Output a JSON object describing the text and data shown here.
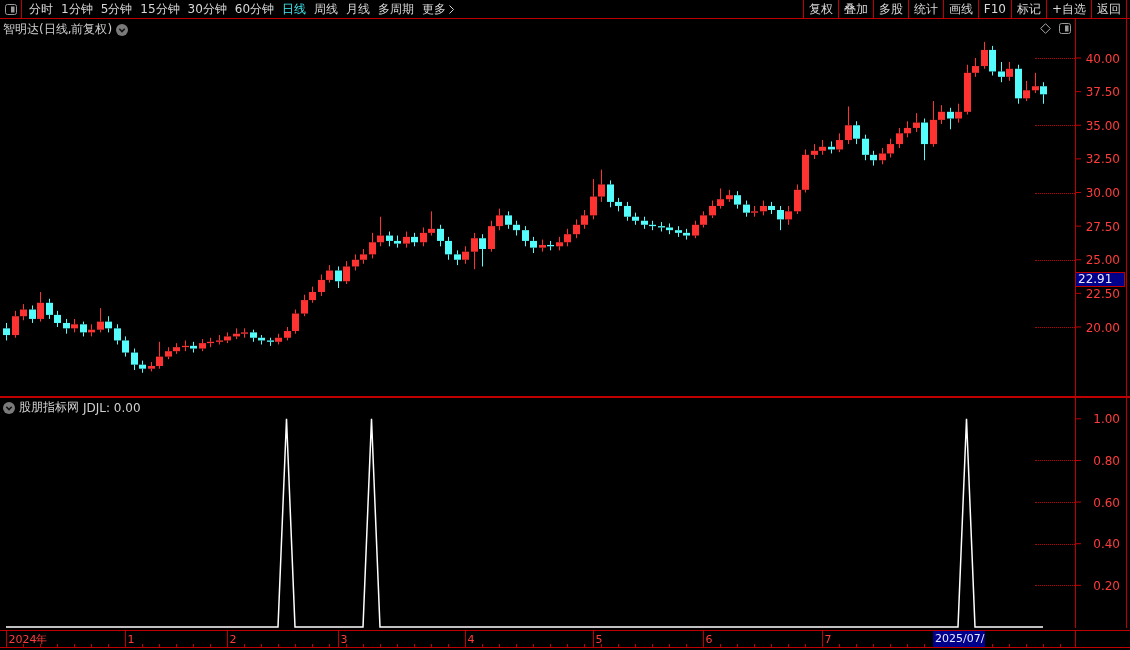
{
  "toolbar": {
    "periods": [
      {
        "label": "分时",
        "selected": false
      },
      {
        "label": "1分钟",
        "selected": false
      },
      {
        "label": "5分钟",
        "selected": false
      },
      {
        "label": "15分钟",
        "selected": false
      },
      {
        "label": "30分钟",
        "selected": false
      },
      {
        "label": "60分钟",
        "selected": false
      },
      {
        "label": "日线",
        "selected": true
      },
      {
        "label": "周线",
        "selected": false
      },
      {
        "label": "月线",
        "selected": false
      },
      {
        "label": "多周期",
        "selected": false
      },
      {
        "label": "更多",
        "selected": false
      }
    ],
    "actions": [
      "复权",
      "叠加",
      "多股",
      "统计",
      "画线",
      "F10",
      "标记",
      "+自选",
      "返回"
    ]
  },
  "price_panel": {
    "title": "智明达(日线,前复权)",
    "cursor_price": "22.91",
    "cursor_date": "2025/07/",
    "chart_data": {
      "type": "candlestick",
      "ylim": [
        14.87,
        42.9
      ],
      "categories": [
        null,
        null,
        null,
        null,
        null,
        null,
        null,
        null,
        null,
        null,
        null,
        null,
        null,
        null,
        null,
        null,
        null,
        null,
        null,
        null,
        null,
        null,
        null,
        null,
        null,
        null,
        null,
        null,
        null,
        null,
        null,
        null,
        null,
        null,
        null,
        null,
        null,
        null,
        null,
        null,
        null,
        null,
        null,
        null,
        null,
        null,
        null,
        null,
        null,
        null,
        null,
        null,
        null,
        null,
        null,
        null,
        null,
        null,
        null,
        null,
        null,
        null,
        null,
        null,
        null,
        null,
        null,
        null,
        null,
        null,
        null,
        null,
        null,
        null,
        null,
        null,
        null,
        null,
        null,
        null,
        null,
        null,
        null,
        null,
        null,
        null,
        null,
        null,
        null,
        null,
        null,
        null,
        null,
        null,
        null,
        null,
        null,
        null,
        null,
        null,
        null,
        null,
        null,
        null,
        null,
        null,
        null,
        null,
        null,
        null,
        null,
        null,
        null,
        null,
        null,
        null,
        null,
        null,
        null,
        null,
        null,
        null,
        null
      ],
      "yticks": [
        {
          "value": 20,
          "label": "20.00"
        },
        {
          "value": 22.5,
          "label": "22.50"
        },
        {
          "value": 25,
          "label": "25.00"
        },
        {
          "value": 27.5,
          "label": "27.50"
        },
        {
          "value": 30,
          "label": "30.00"
        },
        {
          "value": 32.5,
          "label": "32.50"
        },
        {
          "value": 35,
          "label": "35.00"
        },
        {
          "value": 37.5,
          "label": "37.50"
        },
        {
          "value": 40,
          "label": "40.00"
        }
      ],
      "ohlc": [
        [
          19.9,
          20.3,
          19.0,
          19.4
        ],
        [
          19.4,
          21.2,
          19.2,
          20.8
        ],
        [
          20.8,
          21.7,
          20.5,
          21.3
        ],
        [
          21.3,
          21.6,
          20.3,
          20.6
        ],
        [
          20.6,
          22.6,
          20.4,
          21.8
        ],
        [
          21.8,
          22.1,
          20.6,
          20.9
        ],
        [
          20.9,
          21.2,
          20.0,
          20.3
        ],
        [
          20.3,
          20.6,
          19.5,
          19.9
        ],
        [
          19.9,
          20.6,
          19.6,
          20.2
        ],
        [
          20.2,
          20.4,
          19.3,
          19.6
        ],
        [
          19.6,
          20.2,
          19.3,
          19.8
        ],
        [
          19.8,
          21.4,
          19.6,
          20.4
        ],
        [
          20.4,
          20.8,
          19.6,
          19.9
        ],
        [
          19.9,
          20.2,
          18.7,
          19.0
        ],
        [
          19.0,
          19.3,
          17.8,
          18.1
        ],
        [
          18.1,
          18.4,
          16.8,
          17.2
        ],
        [
          17.2,
          17.5,
          16.6,
          16.9
        ],
        [
          16.9,
          17.4,
          16.7,
          17.1
        ],
        [
          17.1,
          18.9,
          16.9,
          17.8
        ],
        [
          17.8,
          18.5,
          17.6,
          18.2
        ],
        [
          18.2,
          18.8,
          18.0,
          18.5
        ],
        [
          18.5,
          19.0,
          18.2,
          18.6
        ],
        [
          18.6,
          18.9,
          18.1,
          18.4
        ],
        [
          18.4,
          19.1,
          18.2,
          18.8
        ],
        [
          18.8,
          19.2,
          18.5,
          18.9
        ],
        [
          18.9,
          19.4,
          18.7,
          19.0
        ],
        [
          19.0,
          19.6,
          18.8,
          19.3
        ],
        [
          19.3,
          19.9,
          19.1,
          19.5
        ],
        [
          19.5,
          19.9,
          19.2,
          19.6
        ],
        [
          19.6,
          19.8,
          18.9,
          19.2
        ],
        [
          19.2,
          19.4,
          18.7,
          19.0
        ],
        [
          19.0,
          19.2,
          18.6,
          18.9
        ],
        [
          18.9,
          19.5,
          18.7,
          19.2
        ],
        [
          19.2,
          20.0,
          19.0,
          19.7
        ],
        [
          19.7,
          21.3,
          19.5,
          21.0
        ],
        [
          21.0,
          22.4,
          20.8,
          22.0
        ],
        [
          22.0,
          23.0,
          21.8,
          22.6
        ],
        [
          22.6,
          23.9,
          22.3,
          23.5
        ],
        [
          23.5,
          24.6,
          23.3,
          24.2
        ],
        [
          24.2,
          24.5,
          22.9,
          23.4
        ],
        [
          23.4,
          24.9,
          23.2,
          24.5
        ],
        [
          24.5,
          25.4,
          24.2,
          25.0
        ],
        [
          25.0,
          25.8,
          24.7,
          25.4
        ],
        [
          25.4,
          27.0,
          25.1,
          26.3
        ],
        [
          26.3,
          28.2,
          26.0,
          26.8
        ],
        [
          26.8,
          27.1,
          26.0,
          26.4
        ],
        [
          26.4,
          26.8,
          25.9,
          26.2
        ],
        [
          26.2,
          27.1,
          25.9,
          26.7
        ],
        [
          26.7,
          27.0,
          26.0,
          26.3
        ],
        [
          26.3,
          27.4,
          26.0,
          27.0
        ],
        [
          27.0,
          28.6,
          26.8,
          27.3
        ],
        [
          27.3,
          27.6,
          26.0,
          26.4
        ],
        [
          26.4,
          26.7,
          25.0,
          25.4
        ],
        [
          25.4,
          25.7,
          24.6,
          25.0
        ],
        [
          25.0,
          26.0,
          24.7,
          25.6
        ],
        [
          25.6,
          27.0,
          24.3,
          26.6
        ],
        [
          26.6,
          26.9,
          24.5,
          25.8
        ],
        [
          25.8,
          27.9,
          25.6,
          27.5
        ],
        [
          27.5,
          28.8,
          27.2,
          28.3
        ],
        [
          28.3,
          28.6,
          27.3,
          27.6
        ],
        [
          27.6,
          27.9,
          26.8,
          27.2
        ],
        [
          27.2,
          27.5,
          26.0,
          26.4
        ],
        [
          26.4,
          26.7,
          25.5,
          25.9
        ],
        [
          25.9,
          26.5,
          25.6,
          26.1
        ],
        [
          26.1,
          26.4,
          25.7,
          26.0
        ],
        [
          26.0,
          26.7,
          25.7,
          26.3
        ],
        [
          26.3,
          27.3,
          26.0,
          26.9
        ],
        [
          26.9,
          28.0,
          26.6,
          27.6
        ],
        [
          27.6,
          28.7,
          27.3,
          28.3
        ],
        [
          28.3,
          31.0,
          28.0,
          29.7
        ],
        [
          29.7,
          31.7,
          29.3,
          30.6
        ],
        [
          30.6,
          30.9,
          28.9,
          29.3
        ],
        [
          29.3,
          29.6,
          28.6,
          29.0
        ],
        [
          29.0,
          29.3,
          27.9,
          28.2
        ],
        [
          28.2,
          28.5,
          27.6,
          27.9
        ],
        [
          27.9,
          28.2,
          27.3,
          27.6
        ],
        [
          27.6,
          27.9,
          27.2,
          27.5
        ],
        [
          27.5,
          27.8,
          27.1,
          27.4
        ],
        [
          27.4,
          27.7,
          26.9,
          27.2
        ],
        [
          27.2,
          27.5,
          26.7,
          27.0
        ],
        [
          27.0,
          27.3,
          26.5,
          26.8
        ],
        [
          26.8,
          27.9,
          26.6,
          27.6
        ],
        [
          27.6,
          28.6,
          27.4,
          28.3
        ],
        [
          28.3,
          29.4,
          28.1,
          29.0
        ],
        [
          29.0,
          30.3,
          28.8,
          29.5
        ],
        [
          29.5,
          30.2,
          29.3,
          29.8
        ],
        [
          29.8,
          30.1,
          28.8,
          29.1
        ],
        [
          29.1,
          29.4,
          28.2,
          28.5
        ],
        [
          28.5,
          29.0,
          28.2,
          28.6
        ],
        [
          28.6,
          29.4,
          28.3,
          29.0
        ],
        [
          29.0,
          29.3,
          28.4,
          28.7
        ],
        [
          28.7,
          29.0,
          27.2,
          28.0
        ],
        [
          28.0,
          29.0,
          27.6,
          28.6
        ],
        [
          28.6,
          30.6,
          28.4,
          30.2
        ],
        [
          30.2,
          33.2,
          30.0,
          32.8
        ],
        [
          32.8,
          33.6,
          32.5,
          33.1
        ],
        [
          33.1,
          33.9,
          32.8,
          33.4
        ],
        [
          33.4,
          33.8,
          32.9,
          33.2
        ],
        [
          33.2,
          34.4,
          33.0,
          33.9
        ],
        [
          33.9,
          36.4,
          33.6,
          35.0
        ],
        [
          35.0,
          35.3,
          33.6,
          34.0
        ],
        [
          34.0,
          34.3,
          32.4,
          32.8
        ],
        [
          32.8,
          33.1,
          32.0,
          32.4
        ],
        [
          32.4,
          33.3,
          32.1,
          32.9
        ],
        [
          32.9,
          34.0,
          32.6,
          33.6
        ],
        [
          33.6,
          34.8,
          33.3,
          34.4
        ],
        [
          34.4,
          35.3,
          34.1,
          34.8
        ],
        [
          34.8,
          35.9,
          34.5,
          35.2
        ],
        [
          35.2,
          35.5,
          32.4,
          33.6
        ],
        [
          33.6,
          36.8,
          33.4,
          35.4
        ],
        [
          35.4,
          36.5,
          35.1,
          36.0
        ],
        [
          36.0,
          36.3,
          34.7,
          35.5
        ],
        [
          35.5,
          36.6,
          35.2,
          36.0
        ],
        [
          36.0,
          39.5,
          35.8,
          38.9
        ],
        [
          38.9,
          40.0,
          38.6,
          39.4
        ],
        [
          39.4,
          41.2,
          39.2,
          40.6
        ],
        [
          40.6,
          40.9,
          38.7,
          39.0
        ],
        [
          39.0,
          39.7,
          38.2,
          38.6
        ],
        [
          38.6,
          39.7,
          38.3,
          39.2
        ],
        [
          39.2,
          39.5,
          36.6,
          37.0
        ],
        [
          37.0,
          38.3,
          36.8,
          37.6
        ],
        [
          37.6,
          38.9,
          37.4,
          37.9
        ],
        [
          37.9,
          38.2,
          36.6,
          37.3
        ]
      ]
    }
  },
  "indicator_panel": {
    "title": "股朋指标网",
    "reading": "JDJL: 0.00",
    "chart_data": {
      "type": "line",
      "ylim": [
        -0.005,
        1.1
      ],
      "categories": [
        null,
        null,
        null,
        null,
        null,
        null,
        null,
        null,
        null,
        null,
        null,
        null,
        null,
        null,
        null,
        null,
        null,
        null,
        null,
        null,
        null,
        null,
        null,
        null,
        null,
        null,
        null,
        null,
        null,
        null,
        null,
        null,
        null,
        null,
        null,
        null,
        null,
        null,
        null,
        null,
        null,
        null,
        null,
        null,
        null,
        null,
        null,
        null,
        null,
        null,
        null,
        null,
        null,
        null,
        null,
        null,
        null,
        null,
        null,
        null,
        null,
        null,
        null,
        null,
        null,
        null,
        null,
        null,
        null,
        null,
        null,
        null,
        null,
        null,
        null,
        null,
        null,
        null,
        null,
        null,
        null,
        null,
        null,
        null,
        null,
        null,
        null,
        null,
        null,
        null,
        null,
        null,
        null,
        null,
        null,
        null,
        null,
        null,
        null,
        null,
        null,
        null,
        null,
        null,
        null,
        null,
        null,
        null,
        null,
        null,
        null,
        null,
        null,
        null,
        null,
        null,
        null,
        null,
        null,
        null,
        null,
        null,
        null
      ],
      "yticks": [
        {
          "value": 0.2,
          "label": "0.20"
        },
        {
          "value": 0.4,
          "label": "0.40"
        },
        {
          "value": 0.6,
          "label": "0.60"
        },
        {
          "value": 0.8,
          "label": "0.80"
        },
        {
          "value": 1,
          "label": "1.00"
        }
      ],
      "series": [
        {
          "color": "#ffffff",
          "values": [
            0,
            0,
            0,
            0,
            0,
            0,
            0,
            0,
            0,
            0,
            0,
            0,
            0,
            0,
            0,
            0,
            0,
            0,
            0,
            0,
            0,
            0,
            0,
            0,
            0,
            0,
            0,
            0,
            0,
            0,
            0,
            0,
            0,
            1,
            0,
            0,
            0,
            0,
            0,
            0,
            0,
            0,
            0,
            1,
            0,
            0,
            0,
            0,
            0,
            0,
            0,
            0,
            0,
            0,
            0,
            0,
            0,
            0,
            0,
            0,
            0,
            0,
            0,
            0,
            0,
            0,
            0,
            0,
            0,
            0,
            0,
            0,
            0,
            0,
            0,
            0,
            0,
            0,
            0,
            0,
            0,
            0,
            0,
            0,
            0,
            0,
            0,
            0,
            0,
            0,
            0,
            0,
            0,
            0,
            0,
            0,
            0,
            0,
            0,
            0,
            0,
            0,
            0,
            0,
            0,
            0,
            0,
            0,
            0,
            0,
            0,
            0,
            0,
            1,
            0,
            0,
            0,
            0,
            0,
            0,
            0,
            0,
            0
          ]
        }
      ]
    }
  },
  "date_axis": {
    "labels": [
      "2024年",
      "1",
      "2",
      "3",
      "4",
      "5",
      "6",
      "7"
    ]
  }
}
